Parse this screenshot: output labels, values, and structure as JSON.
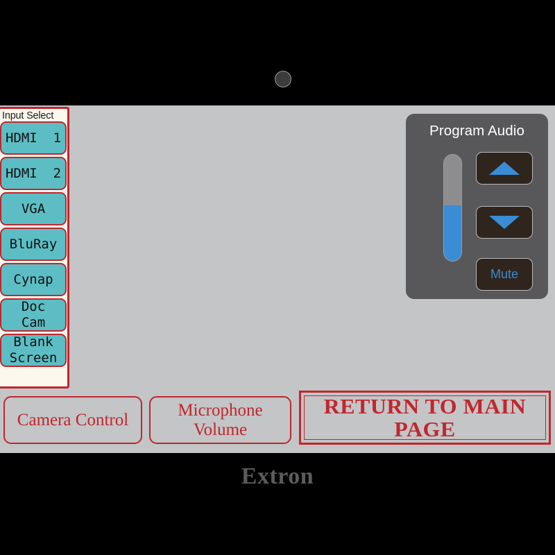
{
  "device": {
    "brand": "Extron",
    "bezel_color": "#000000",
    "screen_bg": "#c3c5c7",
    "hardware": {
      "grille_left": "speaker-grille",
      "grille_right": "speaker-grille",
      "camera": "camera-lens"
    }
  },
  "input_select": {
    "title": "Input Select",
    "panel_bg": "#fdf8ee",
    "border_color": "#c0272d",
    "button_color": "#5cbec4",
    "buttons": [
      {
        "label": "HDMI  1"
      },
      {
        "label": "HDMI  2"
      },
      {
        "label": "VGA"
      },
      {
        "label": "BluRay"
      },
      {
        "label": "Cynap"
      },
      {
        "label": "Doc\nCam"
      },
      {
        "label": "Blank\nScreen"
      }
    ]
  },
  "program_audio": {
    "title": "Program Audio",
    "panel_bg": "#58585a",
    "accent_color": "#3a8dd4",
    "slider": {
      "name": "volume-slider",
      "level_percent": 52,
      "track_color": "#8d8d8f",
      "fill_color": "#3a8dd4"
    },
    "volume_up_label": "",
    "volume_down_label": "",
    "mute_label": "Mute"
  },
  "nav": {
    "camera_control": "Camera\nControl",
    "microphone_volume": "Microphone\nVolume",
    "return_main_page": "RETURN TO\nMAIN PAGE",
    "accent_color": "#c0272d"
  }
}
